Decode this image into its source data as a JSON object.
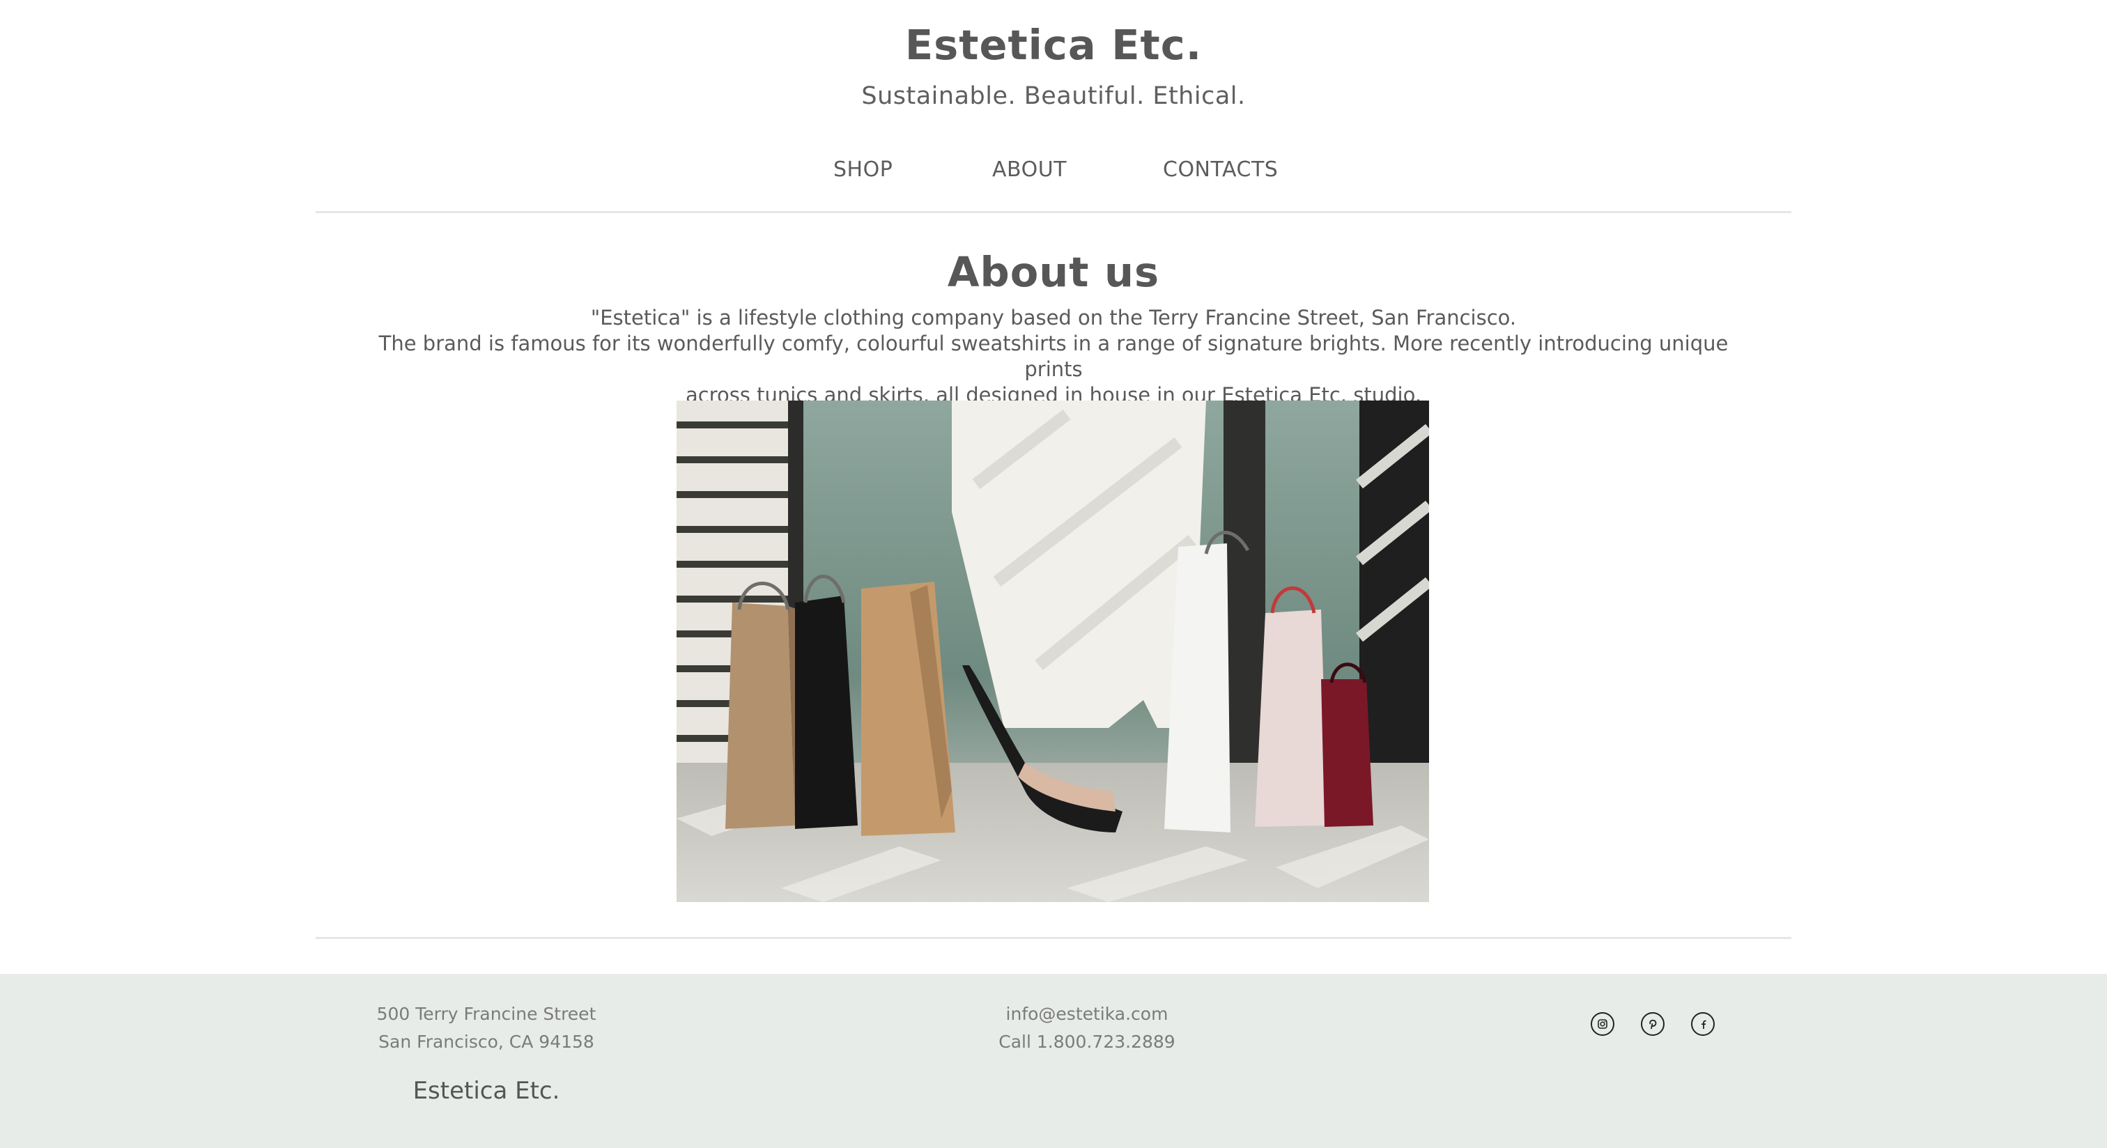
{
  "header": {
    "title": "Estetica Etc.",
    "tagline": "Sustainable. Beautiful. Ethical."
  },
  "nav": {
    "items": [
      {
        "label": "SHOP"
      },
      {
        "label": "ABOUT"
      },
      {
        "label": "CONTACTS"
      }
    ]
  },
  "about": {
    "title": "About us",
    "lines": [
      "\"Estetica\" is a lifestyle clothing company based on the Terry Francine Street, San Francisco.",
      "The brand is famous for its wonderfully comfy, colourful sweatshirts in a range of signature brights. More recently introducing unique prints",
      "across tunics and skirts, all designed in house in our Estetica Etc. studio."
    ],
    "image_description_icon": "shopping-bags-photo"
  },
  "footer": {
    "address_line1": "500 Terry Francine Street",
    "address_line2": "San Francisco, CA 94158",
    "brand": "Estetica Etc.",
    "email": "info@estetika.com",
    "phone": "Call 1.800.723.2889",
    "social": [
      "instagram-icon",
      "pinterest-icon",
      "facebook-icon"
    ],
    "background_color": "#e8ece8"
  },
  "colors": {
    "text": "#575757",
    "divider": "#e6e6e6"
  }
}
